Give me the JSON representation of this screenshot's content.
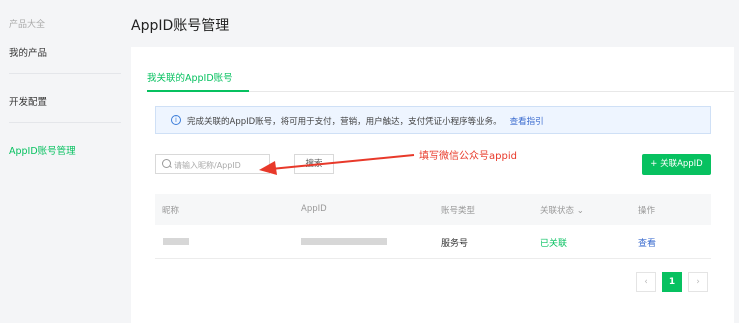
{
  "sidebar": {
    "section_title": "产品大全",
    "items": [
      {
        "label": "我的产品"
      },
      {
        "label": "开发配置"
      },
      {
        "label": "AppID账号管理"
      }
    ]
  },
  "header": {
    "title": "AppID账号管理"
  },
  "tabs": [
    {
      "label": "我关联的AppID账号"
    }
  ],
  "notice": {
    "text": "完成关联的AppID账号，将可用于支付，营销，用户触达，支付凭证小程序等业务。",
    "link": "查看指引"
  },
  "search": {
    "placeholder": "请输入昵称/AppID",
    "button_label": "搜索"
  },
  "add_button_label": "+ 关联AppID",
  "annotation": "填写微信公众号appid",
  "table": {
    "columns": [
      "昵称",
      "AppID",
      "账号类型",
      "关联状态",
      "操作"
    ],
    "rows": [
      {
        "nickname": "",
        "appid": "",
        "type": "服务号",
        "status": "已关联",
        "action": "查看"
      }
    ]
  },
  "pagination": {
    "prev": "‹",
    "current": "1",
    "next": "›"
  },
  "colors": {
    "accent": "#07c160",
    "link": "#3a6bcf",
    "annotation": "#e8392a"
  }
}
